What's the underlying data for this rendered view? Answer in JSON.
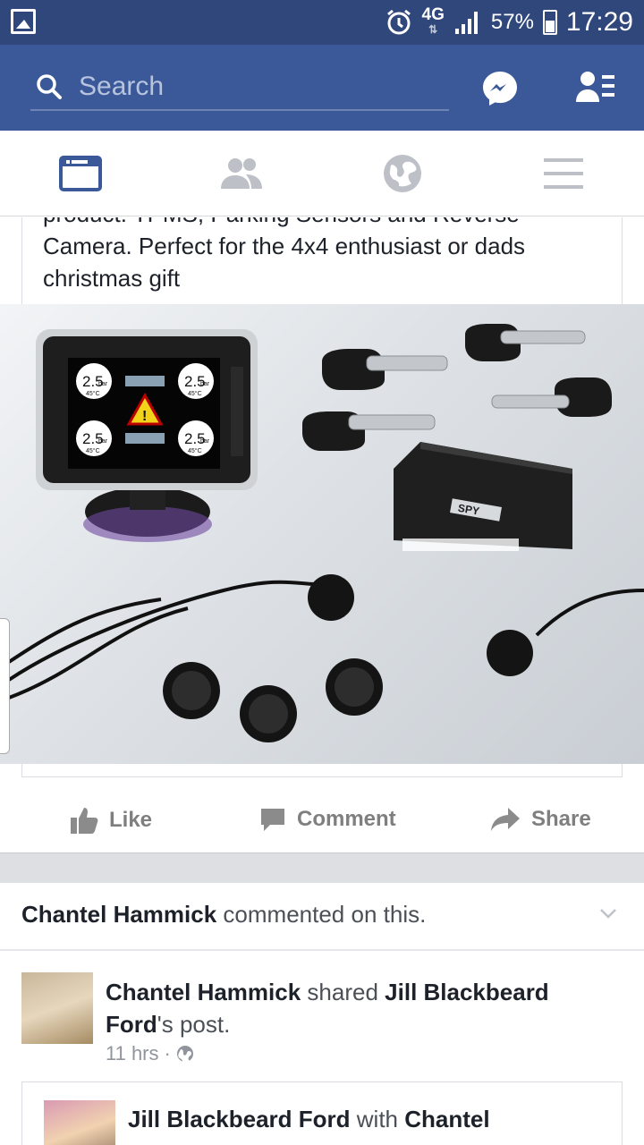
{
  "status_bar": {
    "network": "4G",
    "battery": "57%",
    "time": "17:29"
  },
  "header": {
    "search_placeholder": "Search"
  },
  "tabs": [
    {
      "name": "news-feed",
      "active": true
    },
    {
      "name": "friend-requests",
      "active": false
    },
    {
      "name": "notifications",
      "active": false
    },
    {
      "name": "more",
      "active": false
    }
  ],
  "post": {
    "text_cut": "product: TPMS, Parking Sensors and Reverse",
    "text_visible": "Camera. Perfect for the 4x4 enthusiast or dads christmas gift",
    "display": {
      "tl": "2.5",
      "tr": "2.5",
      "bl": "2.5",
      "br": "2.5",
      "unit": "bar",
      "temp": "45°C"
    },
    "brand": "SPY",
    "actions": {
      "like": "Like",
      "comment": "Comment",
      "share": "Share"
    }
  },
  "story": {
    "commenter": "Chantel Hammick",
    "commented_text": "commented on this.",
    "shared_by": "Chantel Hammick",
    "shared_verb": "shared",
    "shared_owner_first": "Jill Blackbeard",
    "shared_owner_last": "Ford",
    "shared_suffix": "'s post.",
    "time": "11 hrs",
    "inner_author": "Jill Blackbeard Ford",
    "inner_with": "with",
    "inner_tagged": "Chantel"
  },
  "colors": {
    "brand": "#3b5998",
    "status_bar": "#2f477a",
    "text": "#1d2129",
    "muted": "#90949c"
  }
}
